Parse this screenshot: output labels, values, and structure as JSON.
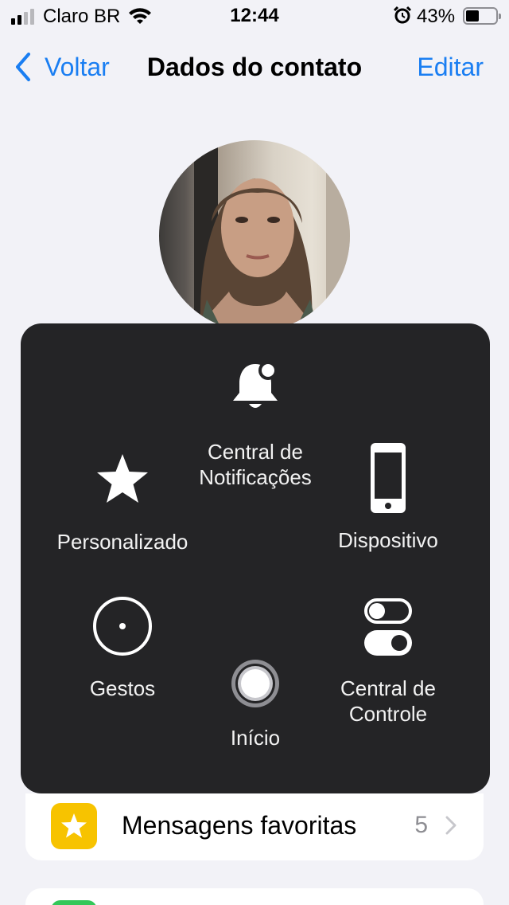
{
  "status_bar": {
    "carrier": "Claro BR",
    "time": "12:44",
    "battery_percent": "43%",
    "icons": [
      "signal-icon",
      "wifi-icon",
      "alarm-icon",
      "battery-icon"
    ]
  },
  "nav": {
    "back_label": "Voltar",
    "title": "Dados do contato",
    "edit_label": "Editar"
  },
  "assistive_touch": {
    "notifications": "Central de\nNotificações",
    "custom": "Personalizado",
    "device": "Dispositivo",
    "gestures": "Gestos",
    "home": "Início",
    "control_center": "Central de\nControle"
  },
  "list": {
    "favorites_label": "Mensagens favoritas",
    "favorites_count": "5"
  },
  "colors": {
    "accent": "#1a7ef2",
    "panel": "#242426",
    "background": "#f2f2f7",
    "favorites_icon": "#f7c300"
  }
}
